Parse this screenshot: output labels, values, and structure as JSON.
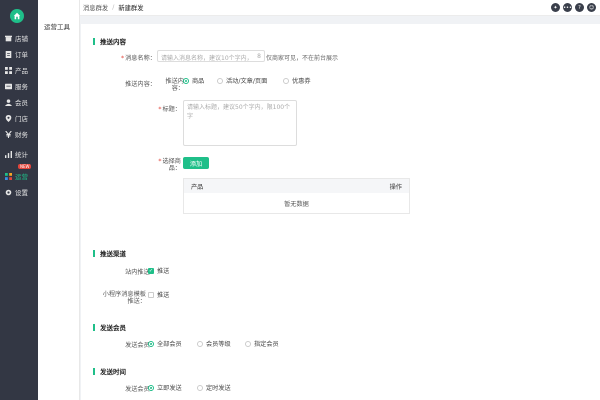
{
  "sidebar": {
    "items": [
      {
        "label": "店铺",
        "icon": "shop-icon"
      },
      {
        "label": "订单",
        "icon": "order-icon"
      },
      {
        "label": "产品",
        "icon": "product-icon"
      },
      {
        "label": "服务",
        "icon": "service-icon"
      },
      {
        "label": "会员",
        "icon": "member-icon"
      },
      {
        "label": "门店",
        "icon": "store-location-icon"
      },
      {
        "label": "财务",
        "icon": "finance-icon"
      },
      {
        "label": "统计",
        "icon": "stats-icon"
      },
      {
        "label": "运营",
        "icon": "operation-icon",
        "badge": "NEW"
      },
      {
        "label": "设置",
        "icon": "settings-icon"
      }
    ],
    "active_color": "#1fbf89"
  },
  "subsidebar": {
    "title": "运营工具"
  },
  "breadcrumb": {
    "parent": "消息群发",
    "sep": "/",
    "current": "新建群发"
  },
  "topbar_icons": [
    "compass-icon",
    "chat-icon",
    "help-icon",
    "user-icon"
  ],
  "push_content": {
    "title": "推送内容",
    "name_label": "消息名称：",
    "name_placeholder": "请输入消息名称，建议10个字内，",
    "name_counter": "8",
    "name_hint": "仅商家可见，不在前台展示",
    "content_label": "推送内容：",
    "content_type_label_1": "推送内",
    "content_type_label_2": "容：",
    "content_types": [
      "商品",
      "活动/文章/页面",
      "优惠券"
    ],
    "content_type_selected": 0,
    "title_label": "标题：",
    "title_placeholder": "请输入标题，建议50个字内，限100个字",
    "select_label_1": "选择商",
    "select_label_2": "品：",
    "add_button": "添加",
    "table_headers": [
      "产品",
      "操作"
    ],
    "table_empty": "暂无数据"
  },
  "push_channel": {
    "title": "推送渠道",
    "inapp_label": "站内推送：",
    "inapp_option": "推送",
    "inapp_checked": true,
    "mp_label_1": "小程序消息模板",
    "mp_label_2": "推送：",
    "mp_option": "推送",
    "mp_checked": false
  },
  "send_member": {
    "title": "发送会员",
    "label": "发送会员：",
    "options": [
      "全部会员",
      "会员等级",
      "指定会员"
    ],
    "selected": 0
  },
  "send_time": {
    "title": "发送时间",
    "label": "发送会员：",
    "options": [
      "立即发送",
      "定时发送"
    ],
    "selected": 0
  },
  "colors": {
    "accent": "#1fbf89",
    "sidebar_bg": "#333744",
    "badge": "#e2453b"
  }
}
